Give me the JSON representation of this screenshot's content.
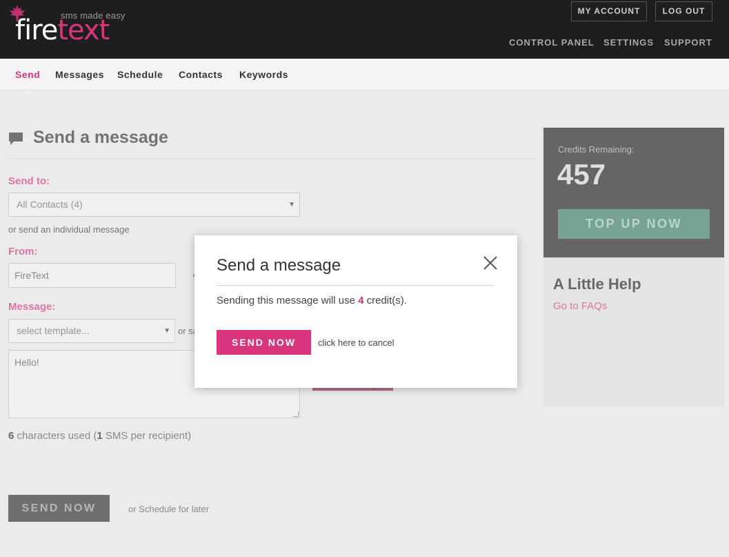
{
  "brand": {
    "tagline": "sms made easy",
    "name_part1": "fire",
    "name_part2": "text",
    "accent_color": "#d9357f"
  },
  "header": {
    "account_button": "MY ACCOUNT",
    "logout_button": "LOG OUT",
    "nav": [
      "CONTROL PANEL",
      "SETTINGS",
      "SUPPORT"
    ]
  },
  "subnav": {
    "items": [
      "Send",
      "Messages",
      "Schedule",
      "Contacts",
      "Keywords"
    ],
    "active": "Send"
  },
  "page": {
    "title": "Send a message"
  },
  "form": {
    "send_to_label": "Send to:",
    "send_to_value": "All Contacts (4)",
    "individual_link": "or send an individual message",
    "from_label": "From:",
    "from_value": "FireText",
    "message_label": "Message:",
    "template_placeholder": "select template...",
    "template_suffix": "or sa",
    "message_text": "Hello!",
    "char_count": "6",
    "char_count_mid": " characters used (",
    "sms_count": "1",
    "sms_suffix": " SMS per recipient)",
    "send_button": "SEND NOW",
    "schedule_link": "or Schedule for later"
  },
  "sidebar": {
    "credits_label": "Credits Remaining:",
    "credits_value": "457",
    "topup_button": "TOP UP NOW",
    "help_title": "A Little Help",
    "help_link": "Go to FAQs"
  },
  "modal": {
    "title": "Send a message",
    "text_before": "Sending this message will use ",
    "credits": "4",
    "text_after": " credit(s).",
    "send_button": "SEND NOW",
    "cancel_link": "click here to cancel"
  },
  "icons": {
    "logo": "maple-leaf-icon",
    "heading": "chat-bubble-icon",
    "close": "close-icon",
    "dropdown": "caret-down-icon"
  }
}
